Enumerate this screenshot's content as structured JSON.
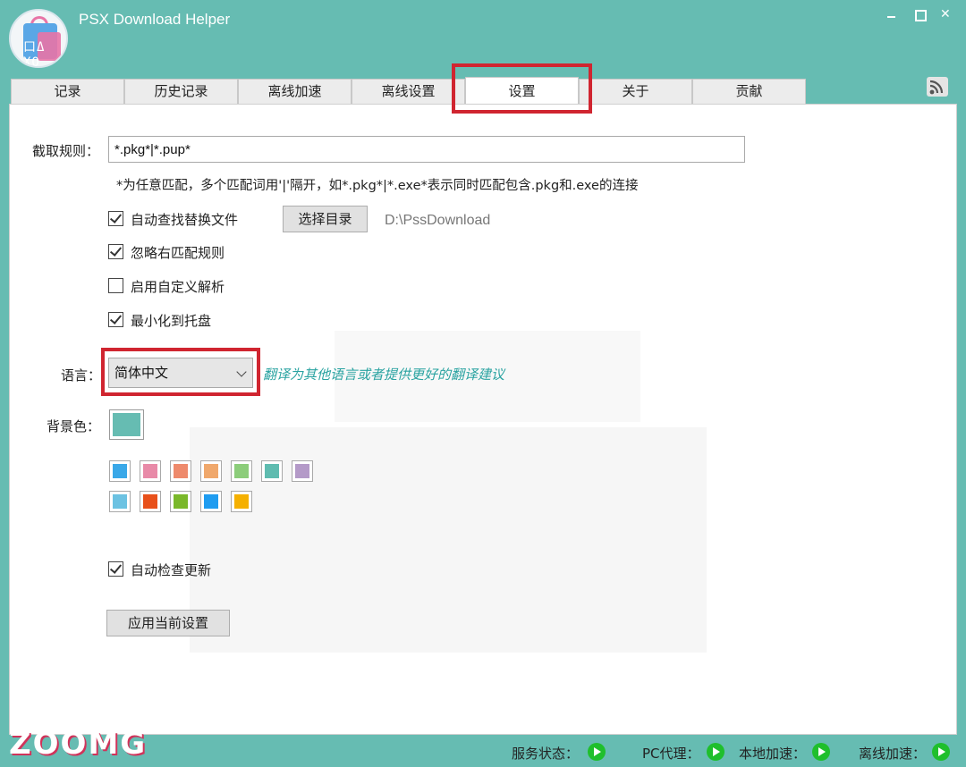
{
  "window": {
    "title": "PSX Download Helper",
    "logo_glyphs": "口Δ XO"
  },
  "tabs": [
    {
      "label": "记录"
    },
    {
      "label": "历史记录"
    },
    {
      "label": "离线加速"
    },
    {
      "label": "离线设置"
    },
    {
      "label": "设置"
    },
    {
      "label": "关于"
    },
    {
      "label": "贡献"
    }
  ],
  "settings": {
    "rule_label": "截取规则：",
    "rule_value": "*.pkg*|*.pup*",
    "rule_hint": "*为任意匹配，多个匹配词用'|'隔开，如*.pkg*|*.exe*表示同时匹配包含.pkg和.exe的连接",
    "auto_find_label": "自动查找替换文件",
    "auto_find_checked": true,
    "choose_dir_button": "选择目录",
    "dir_path": "D:\\PssDownload",
    "ignore_right_label": "忽略右匹配规则",
    "ignore_right_checked": true,
    "custom_parse_label": "启用自定义解析",
    "custom_parse_checked": false,
    "minimize_tray_label": "最小化到托盘",
    "minimize_tray_checked": true,
    "language_label": "语言：",
    "language_selected": "简体中文",
    "translate_link": "翻译为其他语言或者提供更好的翻译建议",
    "bg_color_label": "背景色：",
    "bg_color_current": "#66bcb2",
    "swatches_row1": [
      "#3aa8e8",
      "#e88aa8",
      "#ee8a6c",
      "#f0a86c",
      "#8ccd7a",
      "#5fbcb0",
      "#b49ac8"
    ],
    "swatches_row2": [
      "#6cc2e2",
      "#e8501a",
      "#7ab82a",
      "#1f9cf0",
      "#f5b000"
    ],
    "auto_update_label": "自动检查更新",
    "auto_update_checked": true,
    "apply_button": "应用当前设置"
  },
  "status_bar": {
    "service_label": "服务状态：",
    "pc_proxy_label": "PC代理：",
    "local_accel_label": "本地加速：",
    "offline_accel_label": "离线加速："
  },
  "watermark": "ZOOMG",
  "colors": {
    "app_background": "#66bcb2",
    "highlight_red": "#d02530",
    "status_green": "#1fbf2c",
    "link_teal": "#2aa3a1"
  }
}
